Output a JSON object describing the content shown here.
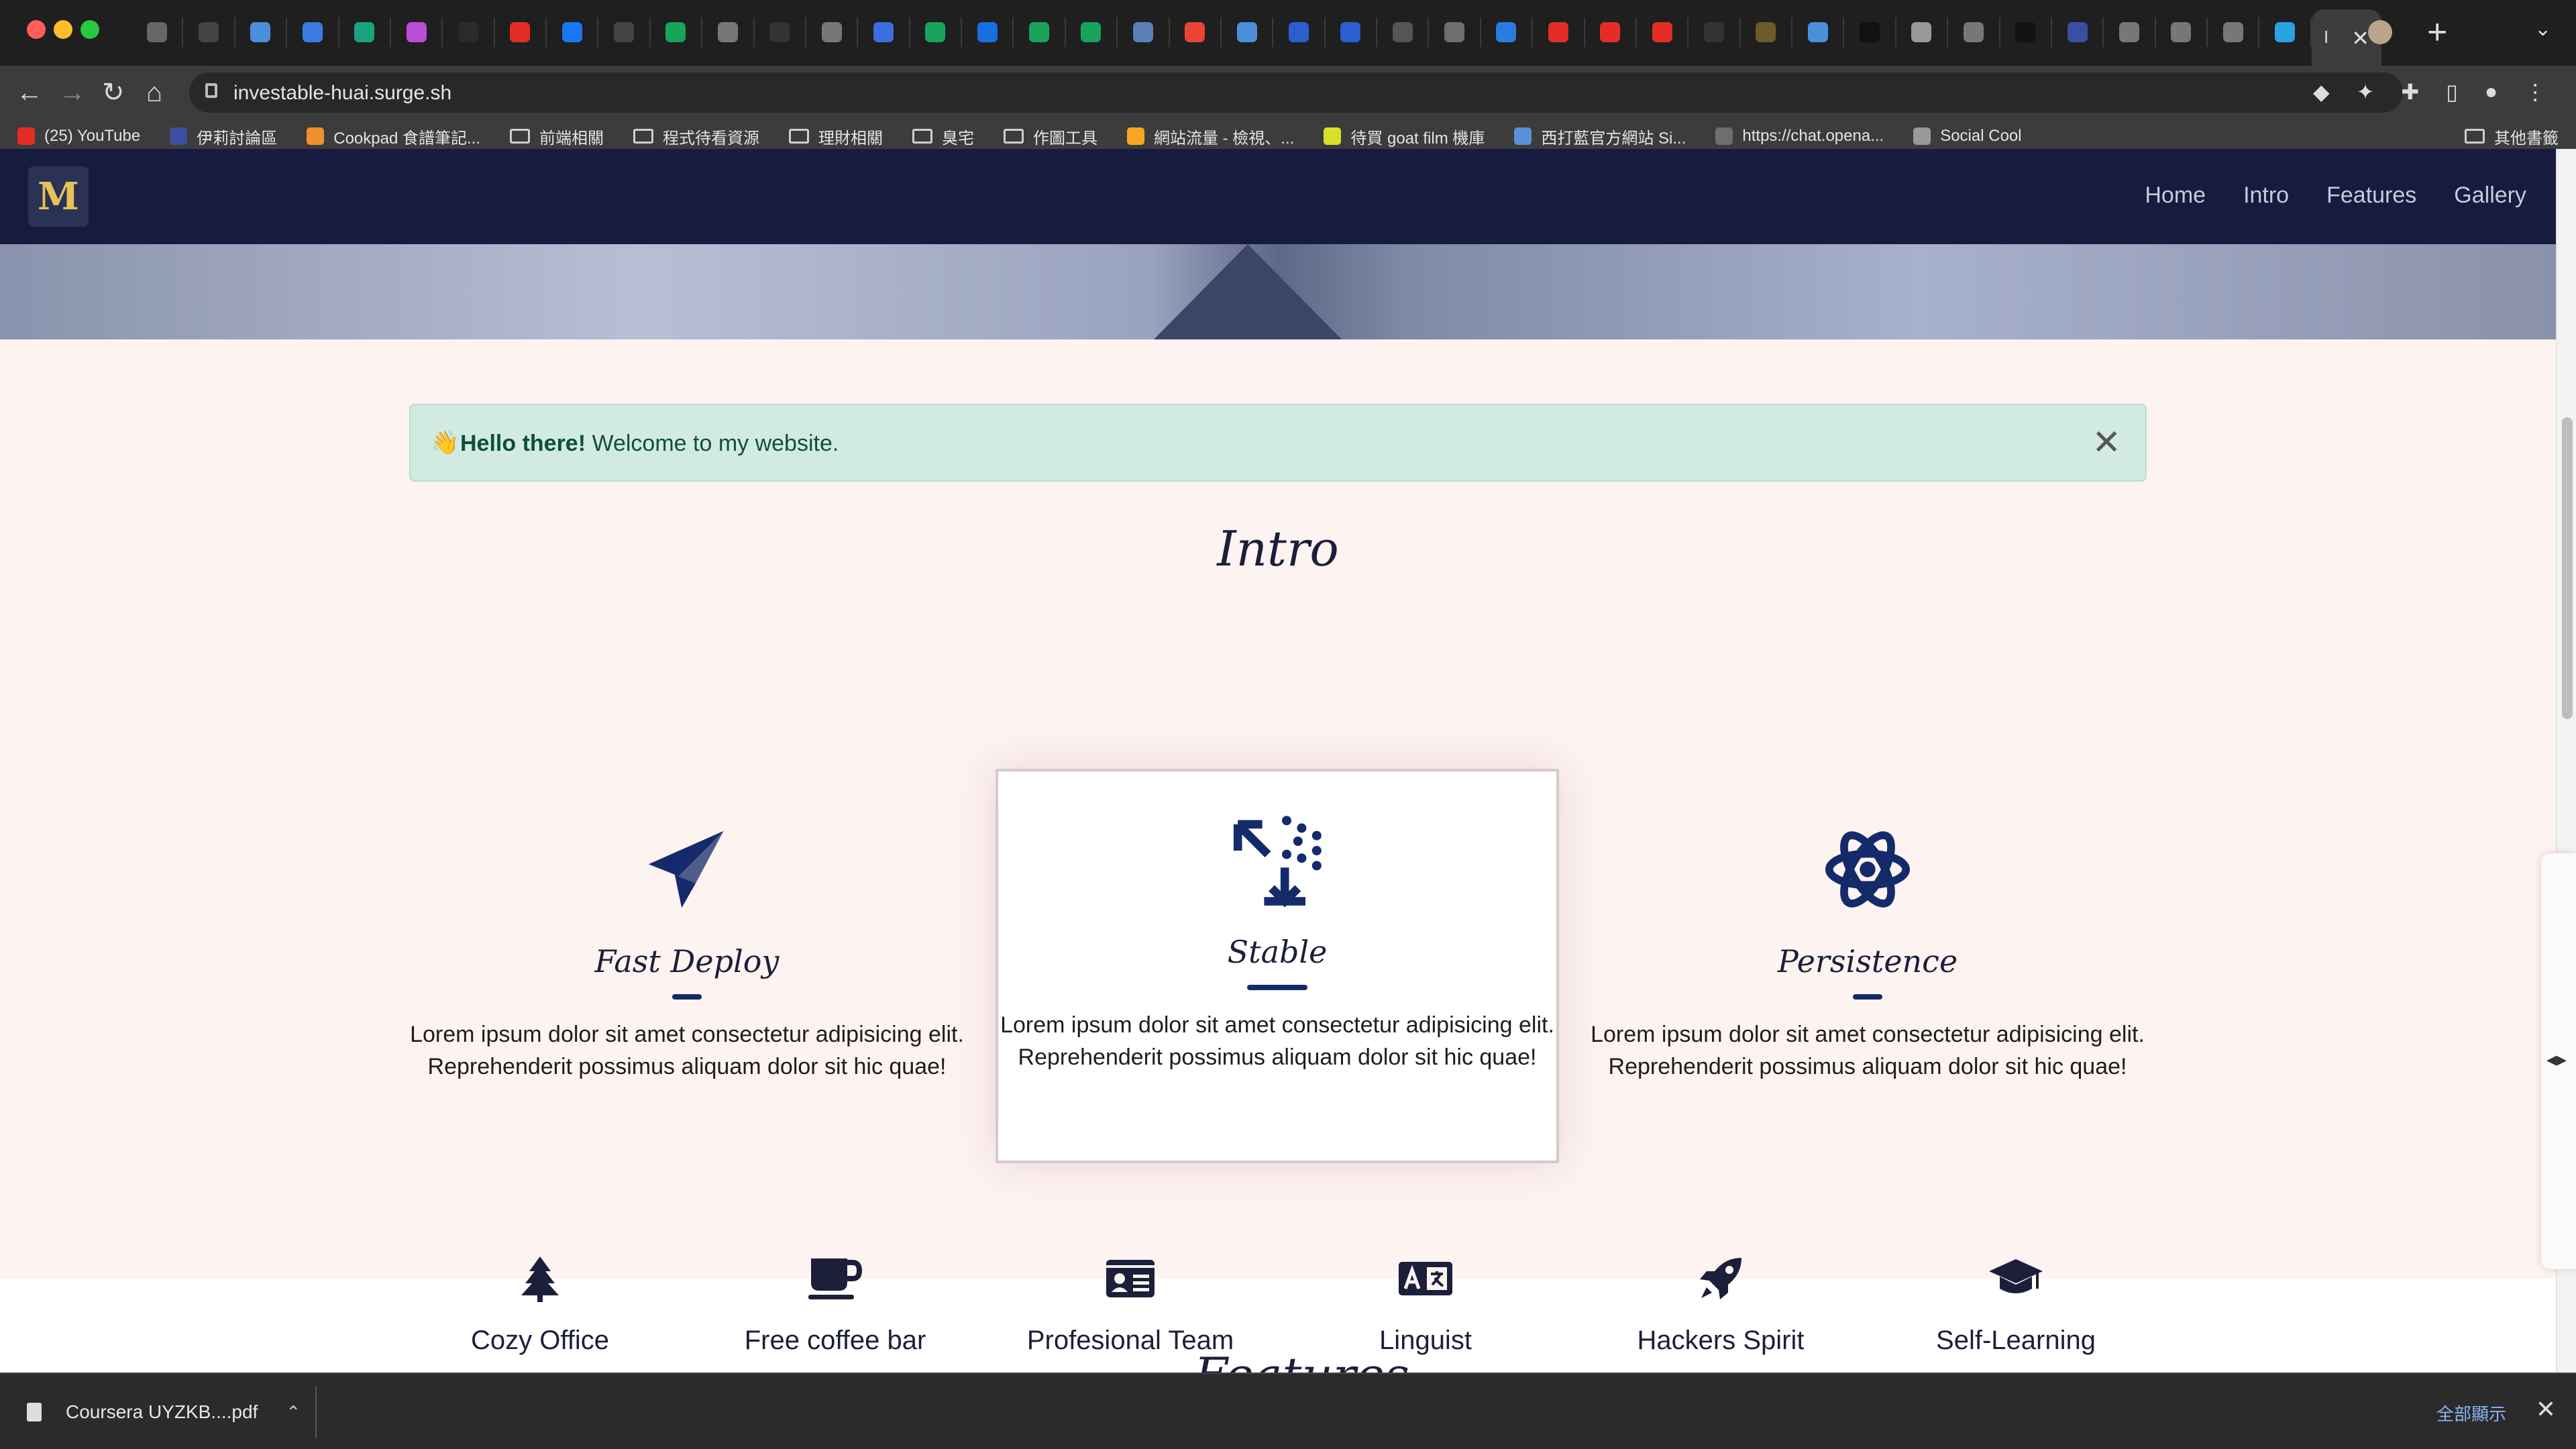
{
  "browser": {
    "tab_icons": [
      {
        "name": "ext-icon",
        "color": "#666"
      },
      {
        "name": "github-icon",
        "color": "#444"
      },
      {
        "name": "translate-icon",
        "color": "#4a8fd9"
      },
      {
        "name": "docs-icon",
        "color": "#3b7be0"
      },
      {
        "name": "chatgpt-icon",
        "color": "#19a37f"
      },
      {
        "name": "star-icon",
        "color": "#b84fd6"
      },
      {
        "name": "dark-icon",
        "color": "#2a2a2a"
      },
      {
        "name": "youtube-icon",
        "color": "#e52d27"
      },
      {
        "name": "facebook-icon",
        "color": "#1877f2"
      },
      {
        "name": "github-icon",
        "color": "#444"
      },
      {
        "name": "c-green-icon",
        "color": "#18a35a"
      },
      {
        "name": "globe-icon",
        "color": "#777"
      },
      {
        "name": "k-icon",
        "color": "#333"
      },
      {
        "name": "doc-icon",
        "color": "#777"
      },
      {
        "name": "heart-icon",
        "color": "#3b6fe0"
      },
      {
        "name": "c-green-icon",
        "color": "#18a35a"
      },
      {
        "name": "c-blue-icon",
        "color": "#1a6fe0"
      },
      {
        "name": "c-green-icon",
        "color": "#18a35a"
      },
      {
        "name": "c-green-icon",
        "color": "#18a35a"
      },
      {
        "name": "ext-icon",
        "color": "#5b7fb8"
      },
      {
        "name": "google-icon",
        "color": "#ea4335"
      },
      {
        "name": "translate-icon",
        "color": "#4a8fd9"
      },
      {
        "name": "bluetooth-icon",
        "color": "#2a5fd0"
      },
      {
        "name": "bluetooth-icon",
        "color": "#2a5fd0"
      },
      {
        "name": "g-icon",
        "color": "#555"
      },
      {
        "name": "chatgpt-icon",
        "color": "#6e6e6e"
      },
      {
        "name": "v-icon",
        "color": "#2a7be0"
      },
      {
        "name": "youtube-icon",
        "color": "#e52d27"
      },
      {
        "name": "youtube-icon",
        "color": "#e52d27"
      },
      {
        "name": "youtube-icon",
        "color": "#e52d27"
      },
      {
        "name": "z-icon",
        "color": "#333"
      },
      {
        "name": "ext-icon",
        "color": "#6b5a2a"
      },
      {
        "name": "translate-icon",
        "color": "#4a8fd9"
      },
      {
        "name": "triangle-icon",
        "color": "#111"
      },
      {
        "name": "wedge-icon",
        "color": "#999"
      },
      {
        "name": "doc-icon",
        "color": "#777"
      },
      {
        "name": "medium-icon",
        "color": "#111"
      },
      {
        "name": "ext-icon",
        "color": "#3b4fa0"
      },
      {
        "name": "globe-icon",
        "color": "#777"
      },
      {
        "name": "globe-icon",
        "color": "#777"
      },
      {
        "name": "globe-icon",
        "color": "#777"
      },
      {
        "name": "surge-icon",
        "color": "#2aa3e0"
      }
    ],
    "active_tab_label": "I",
    "url": "investable-huai.surge.sh",
    "bookmarks": [
      {
        "label": "(25) YouTube",
        "type": "site",
        "color": "#e52d27"
      },
      {
        "label": "伊莉討論區",
        "type": "site",
        "color": "#3b4fa0"
      },
      {
        "label": "Cookpad 食譜筆記...",
        "type": "site",
        "color": "#f0902a"
      },
      {
        "label": "前端相關",
        "type": "folder"
      },
      {
        "label": "程式待看資源",
        "type": "folder"
      },
      {
        "label": "理財相關",
        "type": "folder"
      },
      {
        "label": "臭宅",
        "type": "folder"
      },
      {
        "label": "作圖工具",
        "type": "folder"
      },
      {
        "label": "網站流量 - 檢視、...",
        "type": "site",
        "color": "#f5a623"
      },
      {
        "label": "待買 goat film 機庫",
        "type": "site",
        "color": "#d8e02a"
      },
      {
        "label": "西打藍官方網站 Si...",
        "type": "site",
        "color": "#5b8fd9"
      },
      {
        "label": "https://chat.opena...",
        "type": "site",
        "color": "#6e6e6e"
      },
      {
        "label": "Social Cool",
        "type": "site",
        "color": "#999"
      }
    ],
    "other_bookmarks": "其他書籤"
  },
  "site": {
    "logo_text": "M",
    "nav": [
      "Home",
      "Intro",
      "Features",
      "Gallery"
    ],
    "alert": {
      "emoji": "👋",
      "bold": "Hello there!",
      "text": " Welcome to my website."
    },
    "intro_title": "Intro",
    "features": [
      {
        "title": "Fast Deploy",
        "icon": "paper-plane-icon",
        "desc": "Lorem ipsum dolor sit amet consectetur adipisicing elit. Reprehenderit possimus aliquam dolor sit hic quae!"
      },
      {
        "title": "Stable",
        "icon": "cube-icon",
        "desc": "Lorem ipsum dolor sit amet consectetur adipisicing elit. Reprehenderit possimus aliquam dolor sit hic quae!"
      },
      {
        "title": "Persistence",
        "icon": "atom-icon",
        "desc": "Lorem ipsum dolor sit amet consectetur adipisicing elit. Reprehenderit possimus aliquam dolor sit hic quae!"
      }
    ],
    "perks": [
      {
        "label": "Cozy Office",
        "icon": "tree-icon"
      },
      {
        "label": "Free coffee bar",
        "icon": "coffee-icon"
      },
      {
        "label": "Profesional Team",
        "icon": "id-card-icon"
      },
      {
        "label": "Linguist",
        "icon": "language-icon"
      },
      {
        "label": "Hackers Spirit",
        "icon": "rocket-icon"
      },
      {
        "label": "Self-Learning",
        "icon": "graduation-cap-icon"
      }
    ],
    "next_section_title": "Features",
    "colors": {
      "nav_bg": "#171b40",
      "accent": "#142a6a",
      "section_bg": "#fdf3f1",
      "alert_bg": "#d2ebe2"
    }
  },
  "downloads": {
    "file": "Coursera UYZKB....pdf",
    "show_all": "全部顯示"
  }
}
